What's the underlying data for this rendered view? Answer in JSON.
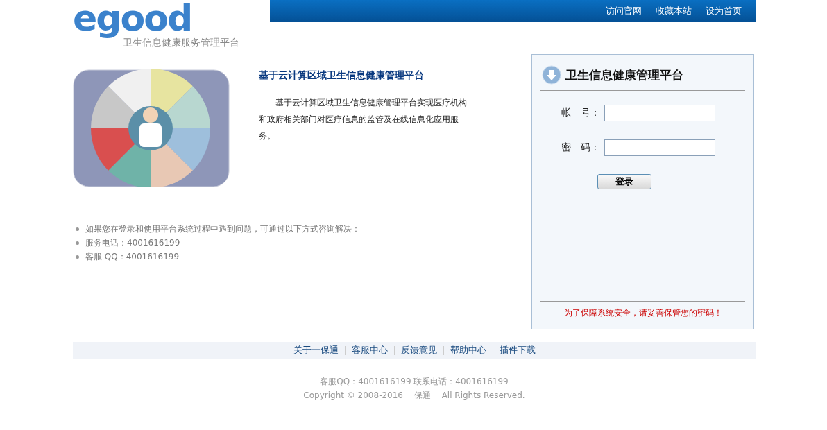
{
  "logo": {
    "text": "egood",
    "tagline": "卫生信息健康服务管理平台"
  },
  "top_links": [
    "访问官网",
    "收藏本站",
    "设为首页"
  ],
  "intro": {
    "title": "基于云计算区域卫生信息健康管理平台",
    "body": "基于云计算区域卫生信息健康管理平台实现医疗机构和政府相关部门对医疗信息的监管及在线信息化应用服务。"
  },
  "help_list": [
    "如果您在登录和使用平台系统过程中遇到问题，可通过以下方式咨询解决：",
    "服务电话：4001616199",
    "客服 QQ：4001616199"
  ],
  "login": {
    "title": "卫生信息健康管理平台",
    "fields": [
      {
        "label": "帐　号："
      },
      {
        "label": "密　码："
      }
    ],
    "button": "登录",
    "notice": "为了保障系统安全，请妥善保管您的密码！"
  },
  "footer_links": [
    "关于一保通",
    "客服中心",
    "反馈意见",
    "帮助中心",
    "插件下载"
  ],
  "footer_lines": [
    "客服QQ：4001616199 联系电话：4001616199",
    "Copyright © 2008-2016 一保通　 All Rights Reserved."
  ]
}
